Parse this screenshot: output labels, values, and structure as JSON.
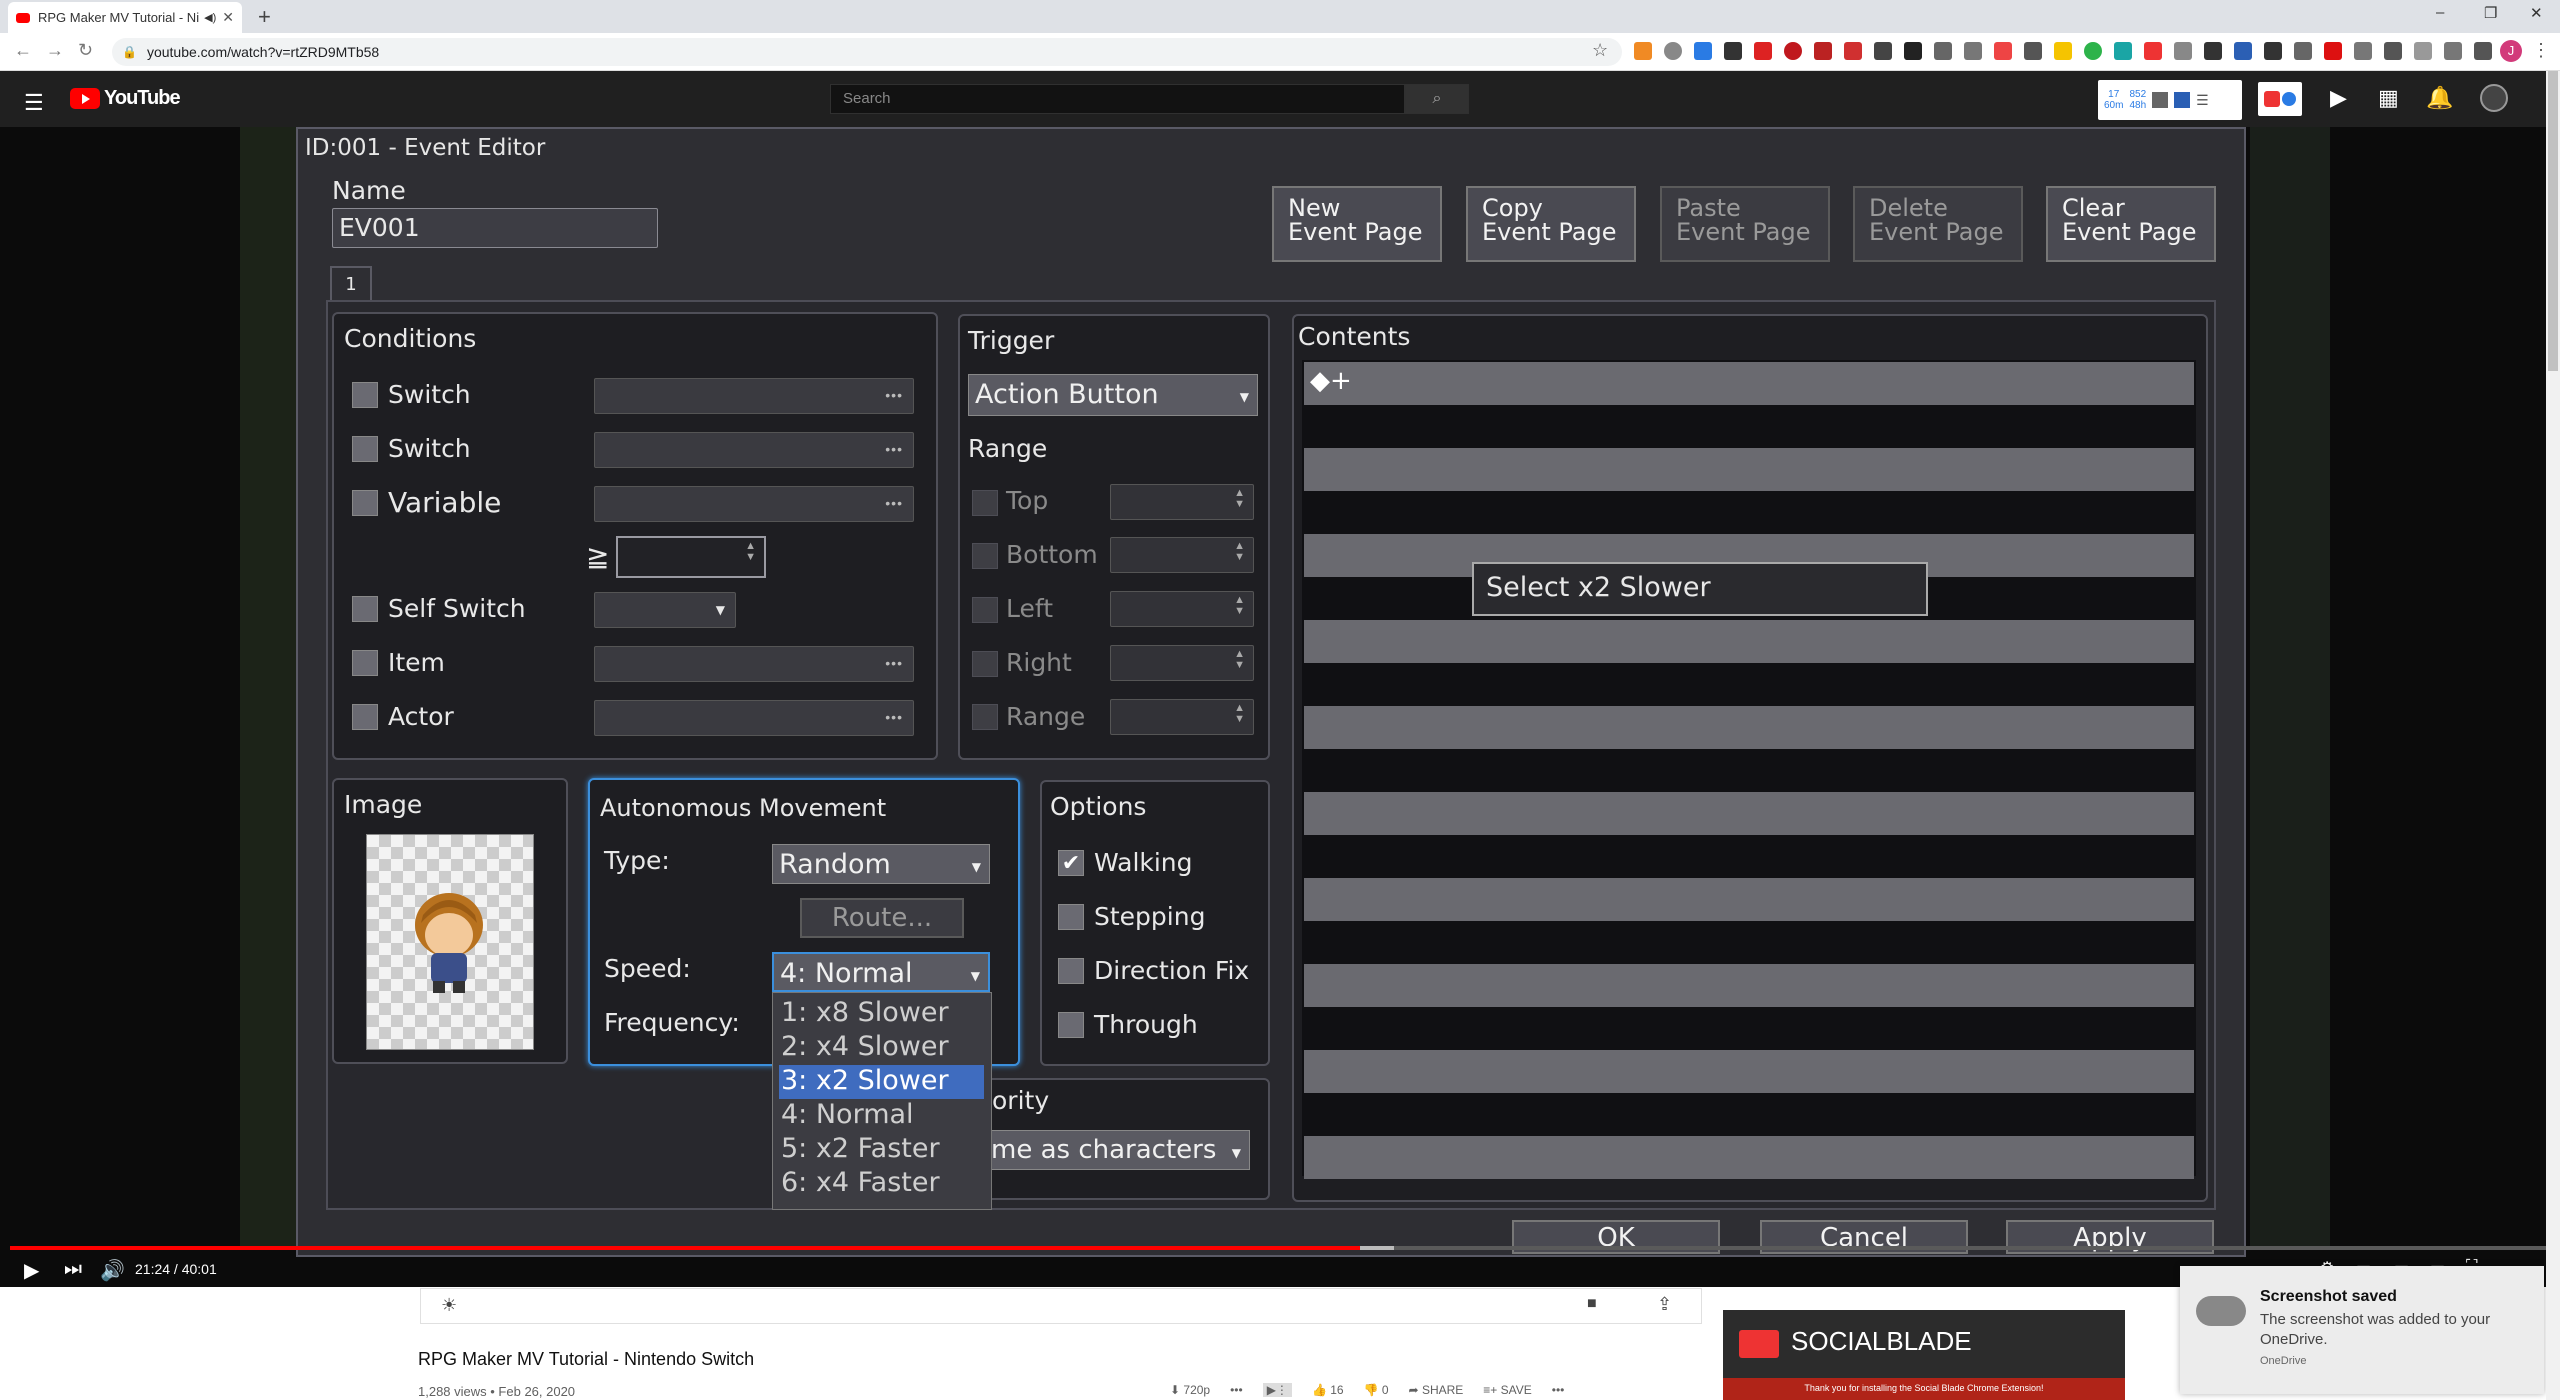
{
  "browser": {
    "tab_title": "RPG Maker MV Tutorial - Ni",
    "tab_close": "✕",
    "new_tab": "+",
    "url": "youtube.com/watch?v=rtZRD9MTb58",
    "window_controls": [
      "–",
      "❐",
      "✕"
    ]
  },
  "youtube": {
    "logo_text": "YouTube",
    "search_placeholder": "Search",
    "socialblade_widget": [
      "17",
      "852",
      "60m",
      "48h"
    ]
  },
  "editor": {
    "title": "ID:001 - Event Editor",
    "name_label": "Name",
    "name_value": "EV001",
    "page_tab": "1",
    "buttons": {
      "new_page": [
        "New",
        "Event Page"
      ],
      "copy_page": [
        "Copy",
        "Event Page"
      ],
      "paste_page": [
        "Paste",
        "Event Page"
      ],
      "delete_page": [
        "Delete",
        "Event Page"
      ],
      "clear_page": [
        "Clear",
        "Event Page"
      ]
    },
    "conditions": {
      "title": "Conditions",
      "switch1": "Switch",
      "switch2": "Switch",
      "variable": "Variable",
      "gte": "≧",
      "self_switch": "Self Switch",
      "item": "Item",
      "actor": "Actor"
    },
    "trigger": {
      "title": "Trigger",
      "value": "Action Button",
      "range_title": "Range",
      "top": "Top",
      "bottom": "Bottom",
      "left": "Left",
      "right": "Right",
      "range": "Range"
    },
    "contents": {
      "title": "Contents",
      "first_row": "◆+",
      "tooltip": "Select x2 Slower"
    },
    "image": {
      "title": "Image"
    },
    "autonomous": {
      "title": "Autonomous Movement",
      "type_label": "Type:",
      "type_value": "Random",
      "route_button": "Route...",
      "speed_label": "Speed:",
      "speed_value": "4: Normal",
      "frequency_label": "Frequency:",
      "speed_options": [
        "1: x8 Slower",
        "2: x4 Slower",
        "3: x2 Slower",
        "4: Normal",
        "5: x2 Faster",
        "6: x4 Faster"
      ],
      "selected_option_index": 2
    },
    "options": {
      "title": "Options",
      "walking": "Walking",
      "walking_checked": true,
      "stepping": "Stepping",
      "direction_fix": "Direction Fix",
      "through": "Through"
    },
    "priority": {
      "title_partial": "ority",
      "value_partial": "me as characters"
    },
    "dialog_buttons": {
      "ok": "OK",
      "cancel": "Cancel",
      "apply": "Apply"
    }
  },
  "player": {
    "time": "21:24 / 40:01",
    "progress_fraction": 0.535
  },
  "video_info": {
    "title": "RPG Maker MV Tutorial - Nintendo Switch",
    "meta": "1,288 views • Feb 26, 2020",
    "quality": "720p",
    "likes": "16",
    "dislikes": "0",
    "share": "SHARE",
    "save": "SAVE"
  },
  "socialblade_ad": {
    "brand": "SOCIALBLADE",
    "message": "Thank you for installing the Social Blade Chrome Extension!"
  },
  "toast": {
    "heading": "Screenshot saved",
    "body": "The screenshot was added to your OneDrive.",
    "source": "OneDrive"
  }
}
